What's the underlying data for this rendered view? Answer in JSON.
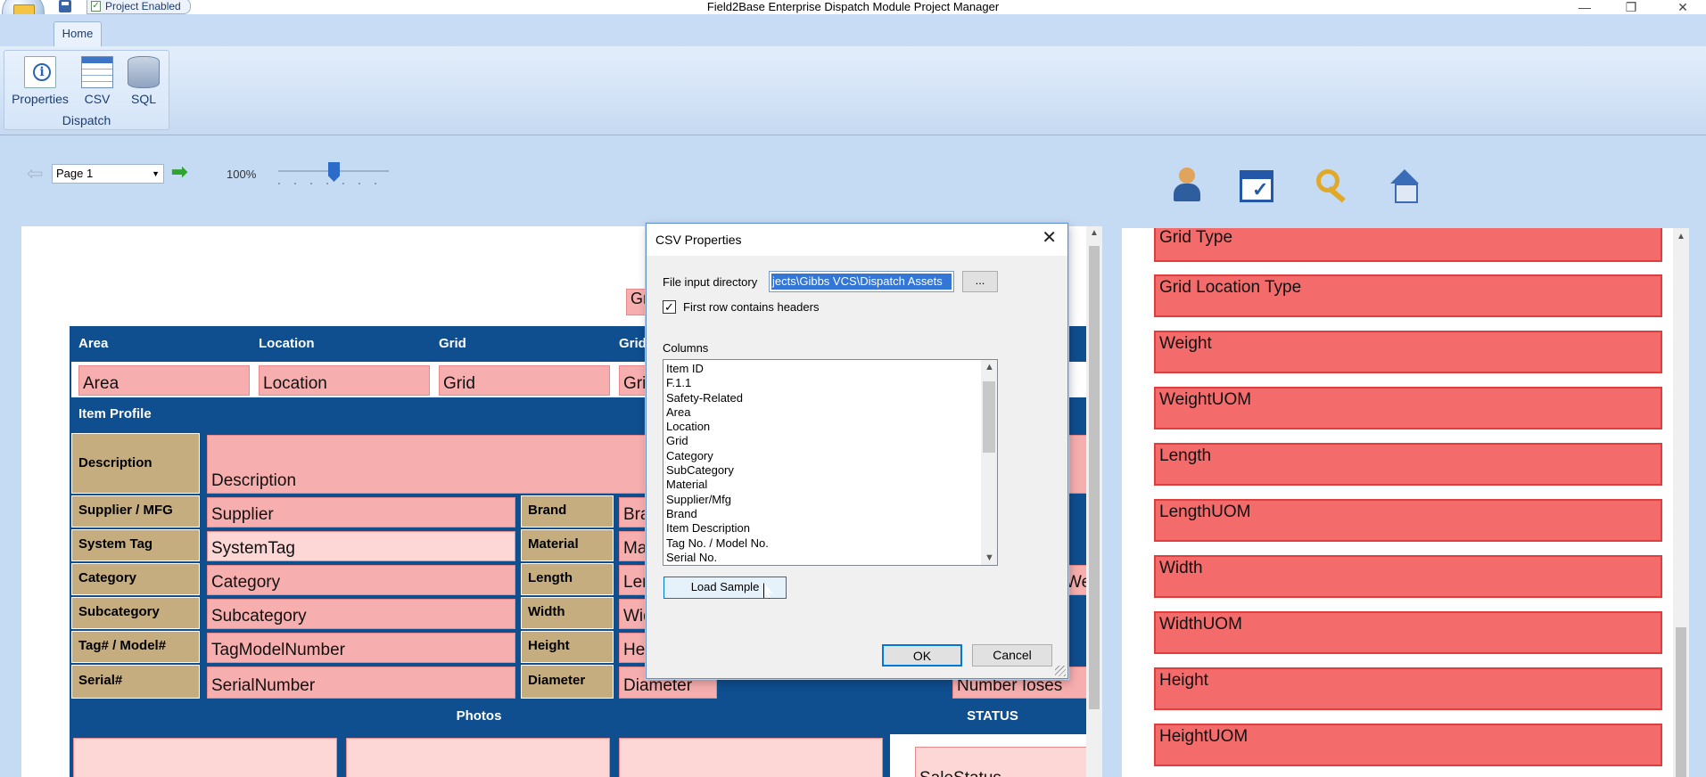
{
  "window": {
    "title": "Field2Base Enterprise Dispatch Module Project Manager",
    "project_status": "Project Enabled",
    "minimize": "—",
    "restore": "❐",
    "close": "✕"
  },
  "ribbon": {
    "tab": "Home",
    "group": "Dispatch",
    "buttons": [
      "Properties",
      "CSV",
      "SQL"
    ]
  },
  "nav": {
    "back_arrow": "⇦",
    "forward_arrow": "➡",
    "page": "Page 1",
    "zoom": "100%",
    "zoom_level_percent": 100
  },
  "form": {
    "partial_field_top": "Gr",
    "headers": [
      "Area",
      "Location",
      "Grid",
      "Grid"
    ],
    "top_fields": [
      "Area",
      "Location",
      "Grid",
      "Gri"
    ],
    "item_profile": "Item Profile",
    "description_label": "Description",
    "description_field": "Description",
    "rows": [
      {
        "label": "Supplier / MFG",
        "field": "Supplier",
        "label2": "Brand",
        "field2": "Bra"
      },
      {
        "label": "System Tag",
        "field": "SystemTag",
        "label2": "Material",
        "field2": "Ma"
      },
      {
        "label": "Category",
        "field": "Category",
        "label2": "Length",
        "field2": "Len"
      },
      {
        "label": "Subcategory",
        "field": "Subcategory",
        "label2": "Width",
        "field2": "Wid"
      },
      {
        "label": "Tag# / Model#",
        "field": "TagModelNumber",
        "label2": "Height",
        "field2": "He"
      },
      {
        "label": "Serial#",
        "field": "SerialNumber",
        "label2": "Diameter",
        "field2": "Diameter"
      }
    ],
    "row3_right_fragment": "We",
    "bottom_right_fragment": "Number Ioses",
    "photos_label": "Photos",
    "status_label": "STATUS",
    "status_field": "SaleStatus"
  },
  "right_panel": {
    "items": [
      "Grid Type",
      "Grid Location Type",
      "Weight",
      "WeightUOM",
      "Length",
      "LengthUOM",
      "Width",
      "WidthUOM",
      "Height",
      "HeightUOM"
    ]
  },
  "dialog": {
    "title": "CSV Properties",
    "close": "✕",
    "file_input_label": "File input directory",
    "file_input_value": "jects\\Gibbs VCS\\Dispatch Assets",
    "browse": "...",
    "first_row_headers_label": "First row contains headers",
    "first_row_headers_checked": true,
    "check_mark": "✓",
    "columns_label": "Columns",
    "columns": [
      "Item ID",
      "F.1.1",
      "Safety-Related",
      "Area",
      "Location",
      "Grid",
      "Category",
      "SubCategory",
      "Material",
      "Supplier/Mfg",
      "Brand",
      "Item Description",
      "Tag No. / Model No.",
      "Serial No."
    ],
    "load_sample": "Load Sample",
    "ok": "OK",
    "cancel": "Cancel"
  }
}
